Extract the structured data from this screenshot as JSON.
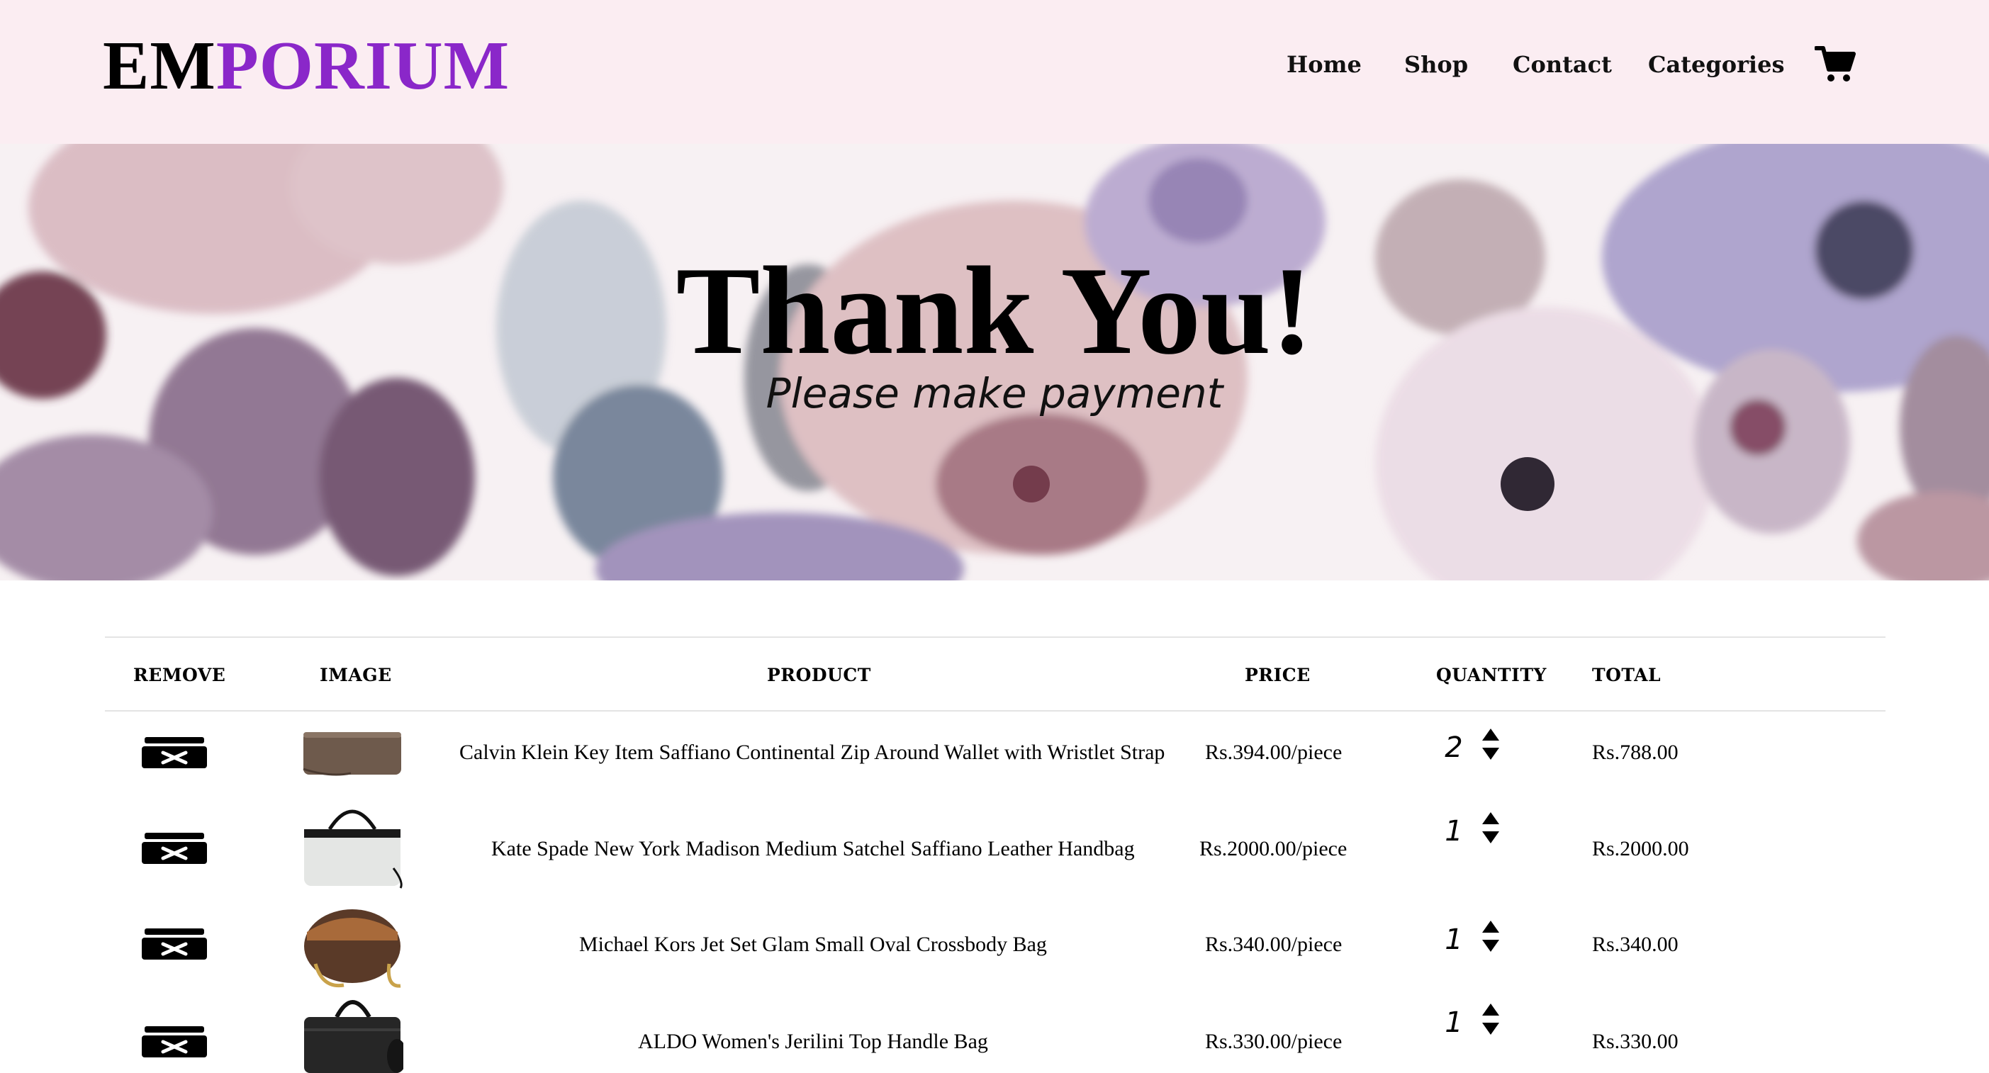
{
  "brand": {
    "prefix": "EM",
    "suffix": "PORIUM",
    "accent_color": "#8a27c9"
  },
  "nav": {
    "items": [
      "Home",
      "Shop",
      "Contact",
      "Categories"
    ],
    "cart_icon": "shopping-cart-icon"
  },
  "banner": {
    "title": "Thank You!",
    "subtitle": "Please make payment"
  },
  "cart_table": {
    "headers": [
      "REMOVE",
      "IMAGE",
      "PRODUCT",
      "PRICE",
      "QUANTITY",
      "TOTAL"
    ],
    "rows": [
      {
        "product": "Calvin Klein Key Item Saffiano Continental Zip Around Wallet with Wristlet Strap",
        "price": "Rs.394.00/piece",
        "quantity": "2",
        "total": "Rs.788.00",
        "image_icon": "wallet-icon"
      },
      {
        "product": "Kate Spade New York Madison Medium Satchel Saffiano Leather Handbag",
        "price": "Rs.2000.00/piece",
        "quantity": "1",
        "total": "Rs.2000.00",
        "image_icon": "handbag-icon"
      },
      {
        "product": "Michael Kors Jet Set Glam Small Oval Crossbody Bag",
        "price": "Rs.340.00/piece",
        "quantity": "1",
        "total": "Rs.340.00",
        "image_icon": "crossbody-bag-icon"
      },
      {
        "product": "ALDO Women's Jerilini Top Handle Bag",
        "price": "Rs.330.00/piece",
        "quantity": "1",
        "total": "Rs.330.00",
        "image_icon": "top-handle-bag-icon"
      }
    ]
  }
}
